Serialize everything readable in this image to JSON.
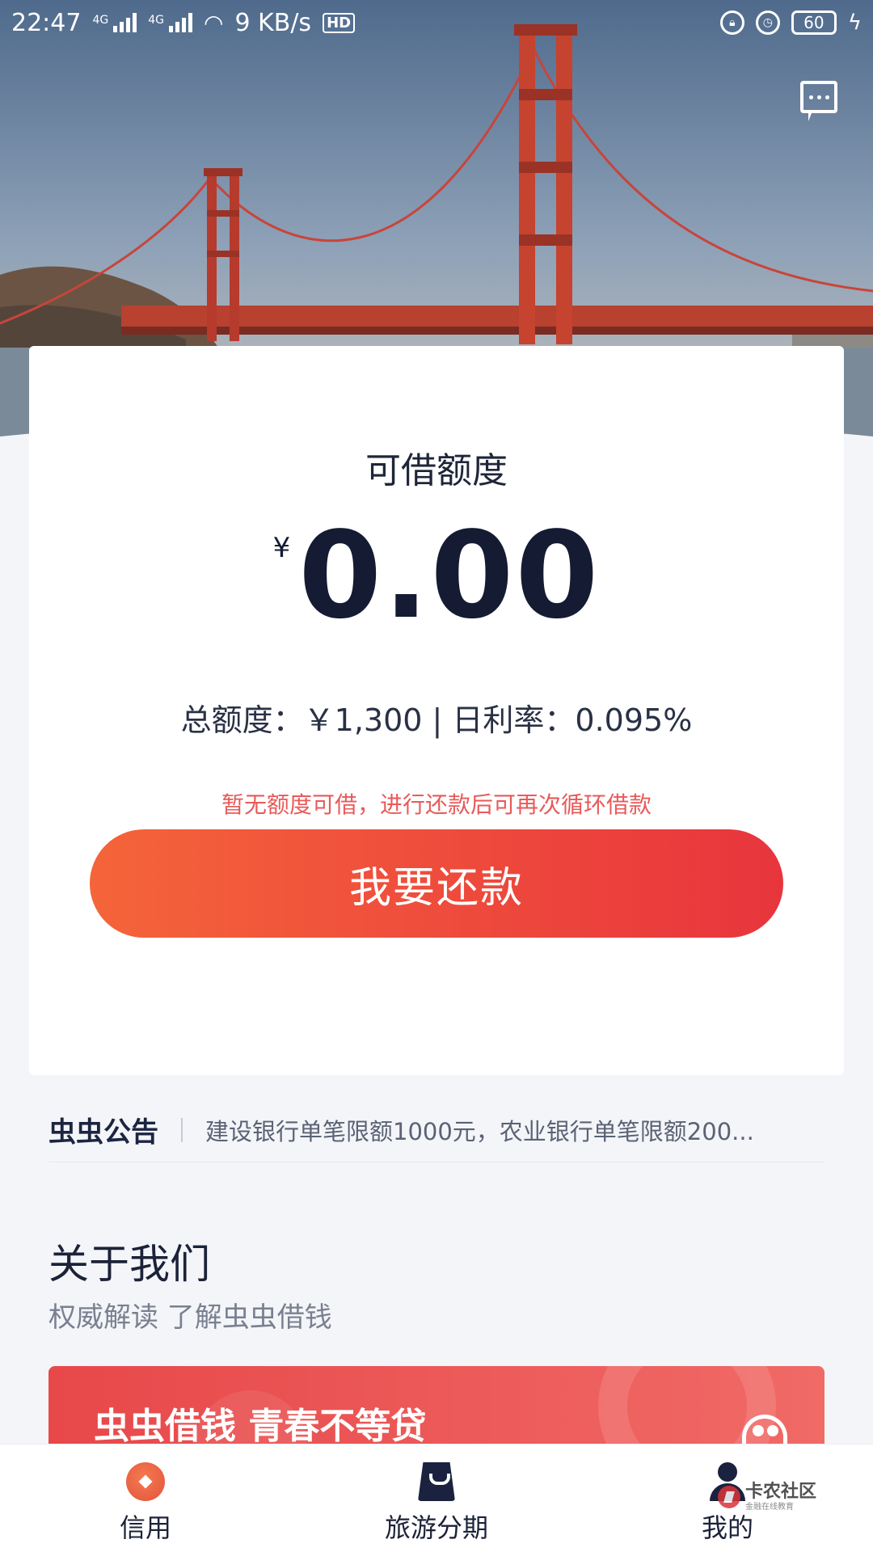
{
  "status_bar": {
    "time": "22:47",
    "network_1": "4G",
    "network_2": "4G",
    "speed": "9 KB/s",
    "hd": "HD",
    "battery": "60"
  },
  "card": {
    "available_label": "可借额度",
    "currency": "¥",
    "amount": "0.00",
    "total_line": "总额度：￥1,300 | 日利率：0.095%",
    "notice": "暂无额度可借，进行还款后可再次循环借款",
    "repay_button": "我要还款"
  },
  "announcement": {
    "title": "虫虫公告",
    "text": "建设银行单笔限额1000元，农业银行单笔限额200..."
  },
  "about": {
    "title": "关于我们",
    "subtitle": "权威解读 了解虫虫借钱",
    "banner_text": "虫虫借钱 青春不等贷"
  },
  "bottom_nav": {
    "items": [
      {
        "label": "信用",
        "icon": "credit-icon"
      },
      {
        "label": "旅游分期",
        "icon": "shopping-bag-icon"
      },
      {
        "label": "我的",
        "icon": "person-icon"
      }
    ]
  },
  "watermark": {
    "main": "卡农社区",
    "sub": "金融在线教育"
  },
  "colors": {
    "accent_start": "#f4643a",
    "accent_end": "#e8353d",
    "notice_red": "#e85a5a",
    "primary_text": "#141b33"
  }
}
